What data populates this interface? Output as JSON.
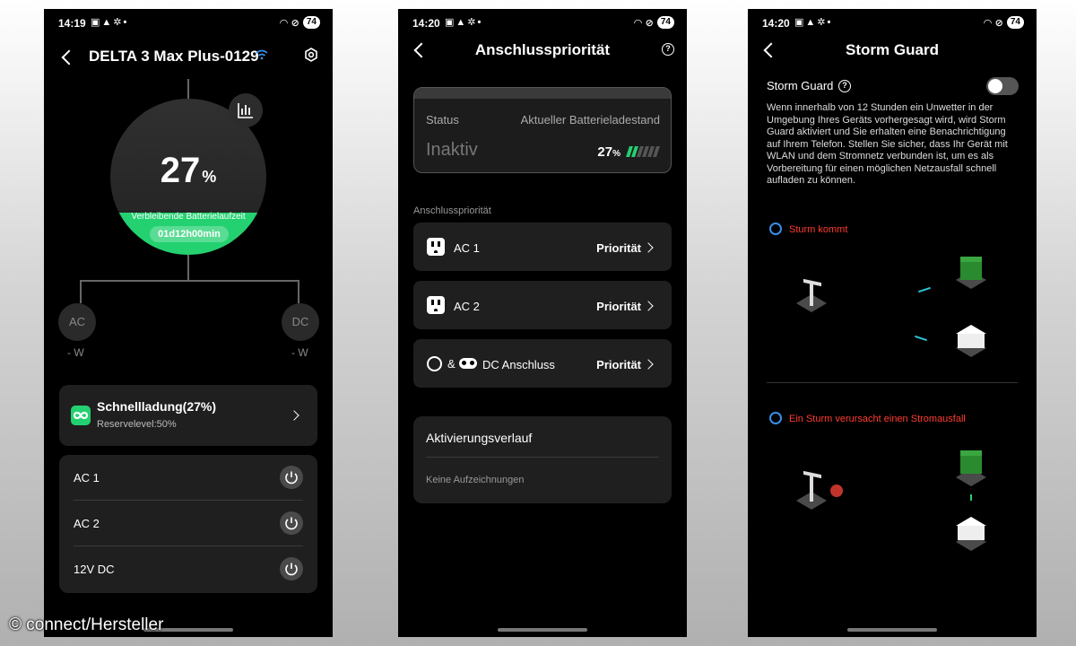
{
  "phone1": {
    "status": {
      "time": "14:19",
      "battery": "74"
    },
    "title": "DELTA 3 Max Plus-0129",
    "battery": {
      "percent": "27",
      "unit": "%",
      "fill_fraction": 0.27,
      "remain_label": "Verbleibende Batterielaufzeit",
      "remain_time": "01d12h00min"
    },
    "ports": {
      "ac": "AC",
      "ac_power": "- W",
      "dc": "DC",
      "dc_power": "- W"
    },
    "fast_charge": {
      "title": "Schnellladung(27%)",
      "subtitle": "Reservelevel:50%"
    },
    "switches": [
      {
        "label": "AC 1"
      },
      {
        "label": "AC 2"
      },
      {
        "label": "12V DC"
      }
    ]
  },
  "phone2": {
    "status": {
      "time": "14:20",
      "battery": "74"
    },
    "title": "Anschlusspriorität",
    "status_card": {
      "status_label": "Status",
      "battery_label": "Aktueller Batterieladestand",
      "state": "Inaktiv",
      "percent": "27",
      "unit": "%"
    },
    "section_label": "Anschlusspriorität",
    "priorities": [
      {
        "name": "AC 1",
        "value": "Priorität"
      },
      {
        "name": "AC 2",
        "value": "Priorität"
      },
      {
        "amp": "&",
        "name": "DC Anschluss",
        "value": "Priorität"
      }
    ],
    "history": {
      "title": "Aktivierungsverlauf",
      "empty": "Keine Aufzeichnungen"
    }
  },
  "phone3": {
    "status": {
      "time": "14:20",
      "battery": "74"
    },
    "title": "Storm Guard",
    "toggle_label": "Storm Guard",
    "toggle_on": false,
    "description": "Wenn innerhalb von 12 Stunden ein Unwetter in der Umgebung Ihres Geräts vorhergesagt wird, wird Storm Guard aktiviert und Sie erhalten eine Benachrichtigung auf Ihrem Telefon. Stellen Sie sicher, dass Ihr Gerät mit WLAN und dem Stromnetz verbunden ist, um es als Vorbereitung für einen möglichen Netzausfall schnell aufladen zu können.",
    "scenario1": "Sturm kommt",
    "scenario2": "Ein Sturm verursacht einen Stromausfall"
  },
  "credit": "© connect/Hersteller",
  "colors": {
    "accent_green": "#23d170",
    "alert_red": "#ff3b30",
    "wifi_blue": "#3a8ee6"
  }
}
